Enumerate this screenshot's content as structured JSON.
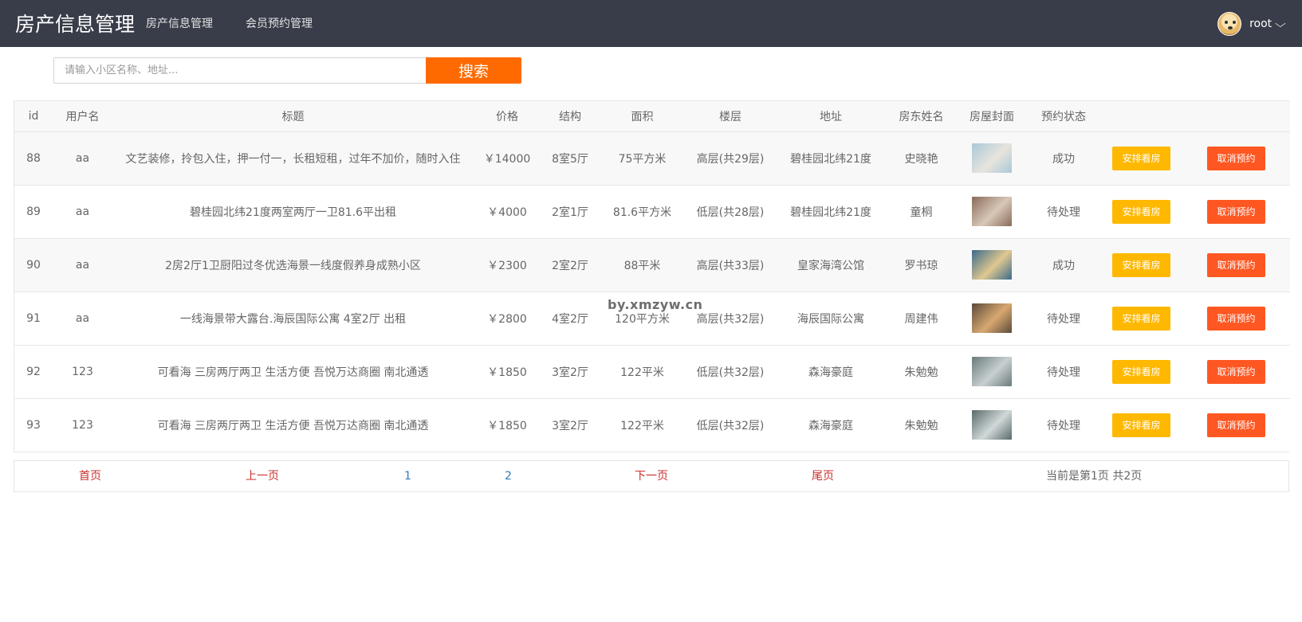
{
  "header": {
    "logo": "房产信息管理",
    "nav": [
      "房产信息管理",
      "会员预约管理"
    ],
    "username": "root",
    "chevron": "⌵",
    "bg_color": "#393d49"
  },
  "search": {
    "placeholder": "请输入小区名称、地址...",
    "value": "",
    "button_label": "搜索",
    "button_color": "#ff6a00"
  },
  "table": {
    "headers": [
      "id",
      "用户名",
      "标题",
      "价格",
      "结构",
      "面积",
      "楼层",
      "地址",
      "房东姓名",
      "房屋封面",
      "预约状态",
      "",
      ""
    ],
    "rows": [
      {
        "id": "88",
        "user": "aa",
        "title": "文艺装修，拎包入住，押一付一，长租短租，过年不加价，随时入住",
        "price": "￥14000",
        "structure": "8室5厅",
        "area": "75平方米",
        "floor": "高层(共29层)",
        "address": "碧桂园北纬21度",
        "landlord": "史晓艳",
        "status": "成功",
        "cover_colors": [
          "#a9c8d8",
          "#e8e4dc"
        ]
      },
      {
        "id": "89",
        "user": "aa",
        "title": "碧桂园北纬21度两室两厅一卫81.6平出租",
        "price": "￥4000",
        "structure": "2室1厅",
        "area": "81.6平方米",
        "floor": "低层(共28层)",
        "address": "碧桂园北纬21度",
        "landlord": "童桐",
        "status": "待处理",
        "cover_colors": [
          "#8a6a5a",
          "#d8c8b8"
        ]
      },
      {
        "id": "90",
        "user": "aa",
        "title": "2房2厅1卫厨阳过冬优选海景一线度假养身成熟小区",
        "price": "￥2300",
        "structure": "2室2厅",
        "area": "88平米",
        "floor": "高层(共33层)",
        "address": "皇家海湾公馆",
        "landlord": "罗书琼",
        "status": "成功",
        "cover_colors": [
          "#3a6a8a",
          "#e0c890"
        ]
      },
      {
        "id": "91",
        "user": "aa",
        "title": "一线海景带大露台.海辰国际公寓 4室2厅 出租",
        "price": "￥2800",
        "structure": "4室2厅",
        "area": "120平方米",
        "floor": "高层(共32层)",
        "address": "海辰国际公寓",
        "landlord": "周建伟",
        "status": "待处理",
        "cover_colors": [
          "#5a4a3a",
          "#d8a870"
        ]
      },
      {
        "id": "92",
        "user": "123",
        "title": "可看海 三房两厅两卫 生活方便 吾悦万达商圈 南北通透",
        "price": "￥1850",
        "structure": "3室2厅",
        "area": "122平米",
        "floor": "低层(共32层)",
        "address": "森海豪庭",
        "landlord": "朱勉勉",
        "status": "待处理",
        "cover_colors": [
          "#6a7a7a",
          "#c8d0d0"
        ]
      },
      {
        "id": "93",
        "user": "123",
        "title": "可看海 三房两厅两卫 生活方便 吾悦万达商圈 南北通透",
        "price": "￥1850",
        "structure": "3室2厅",
        "area": "122平米",
        "floor": "低层(共32层)",
        "address": "森海豪庭",
        "landlord": "朱勉勉",
        "status": "待处理",
        "cover_colors": [
          "#5a6a6a",
          "#d0d8d8"
        ]
      }
    ],
    "arrange_label": "安排看房",
    "cancel_label": "取消预约",
    "arrange_color": "#ffb800",
    "cancel_color": "#ff5722"
  },
  "pager": {
    "first": "首页",
    "prev": "上一页",
    "pages": [
      "1",
      "2"
    ],
    "next": "下一页",
    "last": "尾页",
    "info": "当前是第1页 共2页"
  },
  "watermark": "by.xmzyw.cn"
}
